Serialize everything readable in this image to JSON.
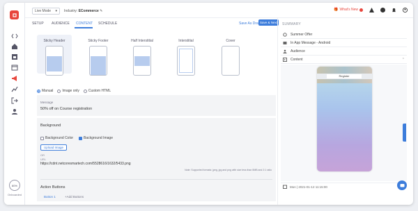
{
  "topbar": {
    "mode": "Live Mode",
    "industry_label": "Industry:",
    "industry_value": "ECommerce",
    "whats_new": "What's New"
  },
  "tabs": [
    {
      "label": "SETUP",
      "active": false
    },
    {
      "label": "AUDIENCE",
      "active": false
    },
    {
      "label": "CONTENT",
      "active": true
    },
    {
      "label": "SCHEDULE",
      "active": false
    }
  ],
  "actions": {
    "save_draft": "Save As Draft",
    "save_next": "Save & Next"
  },
  "layouts": [
    {
      "label": "Sticky Header",
      "selected": true
    },
    {
      "label": "Sticky Footer",
      "selected": false
    },
    {
      "label": "Half Interstitial",
      "selected": false
    },
    {
      "label": "Interstitial",
      "selected": false
    },
    {
      "label": "Cover",
      "selected": false
    }
  ],
  "content_mode": {
    "options": [
      "Manual",
      "Image only",
      "Custom HTML"
    ],
    "selected": "Manual"
  },
  "message": {
    "label": "Message",
    "value": "50% off on Course registration"
  },
  "background": {
    "title": "Background",
    "color_label": "Background Color",
    "image_label": "Background Image",
    "image_checked": true,
    "upload_label": "Upload Image",
    "or_label": "OR",
    "url_label": "URL",
    "url_value": "https://cdnt.netcoresmartech.com/5528616/1632/5433.png",
    "note": "Note: Supported formats: jpeg, jpg and png with size less than 5MB and 2:1 ratio"
  },
  "action_buttons": {
    "title": "Action Buttons",
    "tabs": [
      "Button 1",
      "+Add Buttons"
    ]
  },
  "summary": {
    "title": "SUMMARY",
    "rows": [
      {
        "label": "Summer Offer",
        "icon": "gear-icon"
      },
      {
        "label": "In App Message - Android",
        "icon": "message-icon"
      },
      {
        "label": "Audience",
        "icon": "audience-icon"
      },
      {
        "label": "Content",
        "icon": "content-icon"
      }
    ],
    "preview_button": "Register",
    "schedule": "Mon | 2021-01-12 11:15:00"
  },
  "sidebar_badge": {
    "value": "80%",
    "label": "Onboarded"
  },
  "colors": {
    "accent": "#3d7ddb",
    "brand": "#e8453c"
  }
}
